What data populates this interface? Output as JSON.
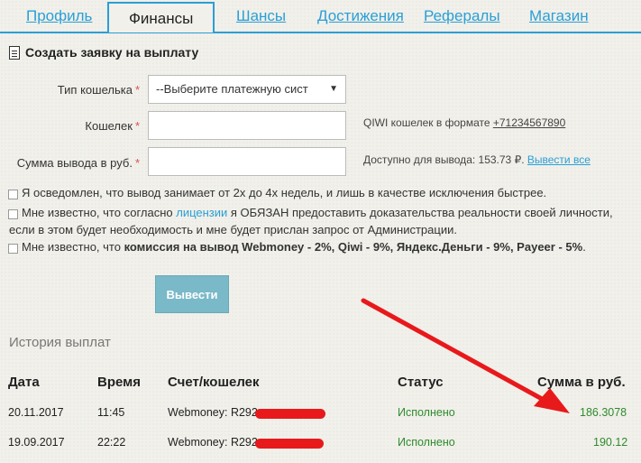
{
  "tabs": [
    {
      "label": "Профиль"
    },
    {
      "label": "Финансы"
    },
    {
      "label": "Шансы"
    },
    {
      "label": "Достижения"
    },
    {
      "label": "Рефералы"
    },
    {
      "label": "Магазин"
    }
  ],
  "form": {
    "title": "Создать заявку на выплату",
    "wallet_type_label": "Тип кошелька",
    "wallet_type_value": "--Выберите платежную сист",
    "wallet_label": "Кошелек",
    "wallet_value": "",
    "wallet_hint_prefix": "QIWI кошелек в формате ",
    "wallet_hint_example": "+71234567890",
    "amount_label": "Сумма вывода в руб.",
    "amount_value": "",
    "available_text": "Доступно для вывода: 153.73 ₽. ",
    "withdraw_all": "Вывести все",
    "required_mark": "*"
  },
  "checks": {
    "c1": "Я осведомлен, что вывод занимает от 2х до 4х недель, и лишь в качестве исключения быстрее.",
    "c2_pre": "Мне известно, что согласно ",
    "c2_link": "лицензии",
    "c2_post": " я ОБЯЗАН предоставить доказательства реальности своей личности,",
    "c2_line2": "если в этом будет необходимость и мне будет прислан запрос от Администрации.",
    "c3_pre": "Мне известно, что ",
    "c3_bold": "комиссия на вывод Webmoney - 2%, Qiwi - 9%, Яндекс.Деньги - 9%, Payeer - 5%",
    "c3_post": "."
  },
  "submit_label": "Вывести",
  "history": {
    "title": "История выплат",
    "headers": {
      "date": "Дата",
      "time": "Время",
      "account": "Счет/кошелек",
      "status": "Статус",
      "sum": "Сумма в руб."
    },
    "rows": [
      {
        "date": "20.11.2017",
        "time": "11:45",
        "account": "Webmoney: R292",
        "status": "Исполнено",
        "sum": "186.3078"
      },
      {
        "date": "19.09.2017",
        "time": "22:22",
        "account": "Webmoney: R292",
        "status": "Исполнено",
        "sum": "190.12"
      }
    ]
  },
  "colors": {
    "accent": "#2a9fd6",
    "status_green": "#2e8b2e",
    "button": "#79b9c8",
    "annotation_red": "#e8191b"
  }
}
